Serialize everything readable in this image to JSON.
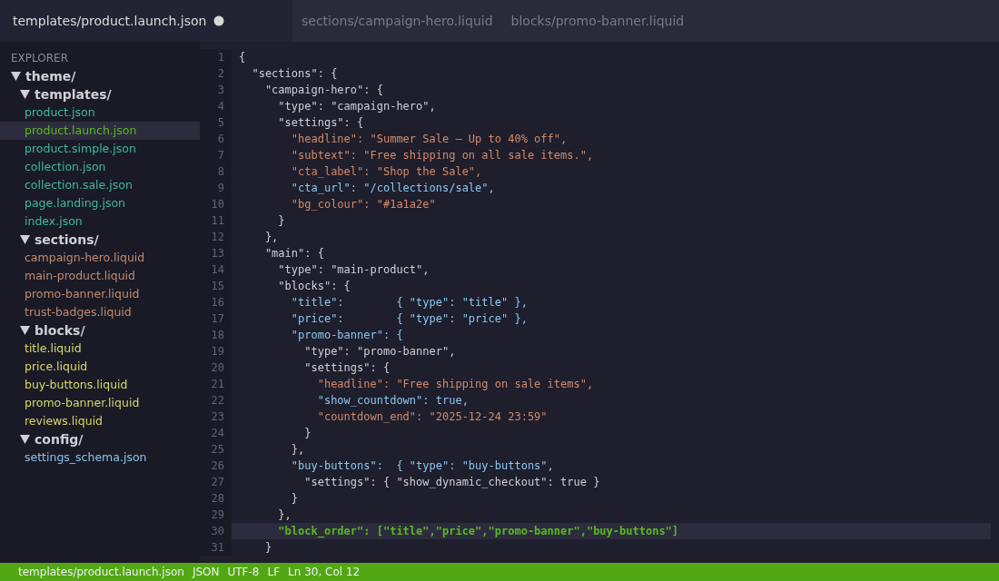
{
  "tabs": [
    {
      "label": "templates/product.launch.json",
      "selected": true,
      "modified": true
    },
    {
      "label": "sections/campaign-hero.liquid",
      "selected": false,
      "modified": false
    },
    {
      "label": "blocks/promo-banner.liquid",
      "selected": false,
      "modified": false
    }
  ],
  "explorer": {
    "title": "EXPLORER",
    "tree": [
      {
        "name": "theme/",
        "expanded": true,
        "children": [
          {
            "name": "templates/",
            "expanded": true,
            "children": [
              {
                "name": "product.json",
                "kind": "template",
                "selected": false
              },
              {
                "name": "product.launch.json",
                "kind": "template",
                "selected": true
              },
              {
                "name": "product.simple.json",
                "kind": "template",
                "selected": false
              },
              {
                "name": "collection.json",
                "kind": "template",
                "selected": false
              },
              {
                "name": "collection.sale.json",
                "kind": "template",
                "selected": false
              },
              {
                "name": "page.landing.json",
                "kind": "template",
                "selected": false
              },
              {
                "name": "index.json",
                "kind": "template",
                "selected": false
              }
            ]
          },
          {
            "name": "sections/",
            "expanded": true,
            "children": [
              {
                "name": "campaign-hero.liquid",
                "kind": "section",
                "selected": false
              },
              {
                "name": "main-product.liquid",
                "kind": "section",
                "selected": false
              },
              {
                "name": "promo-banner.liquid",
                "kind": "section",
                "selected": false
              },
              {
                "name": "trust-badges.liquid",
                "kind": "section",
                "selected": false
              }
            ]
          },
          {
            "name": "blocks/",
            "expanded": true,
            "children": [
              {
                "name": "title.liquid",
                "kind": "block",
                "selected": false
              },
              {
                "name": "price.liquid",
                "kind": "block",
                "selected": false
              },
              {
                "name": "buy-buttons.liquid",
                "kind": "block",
                "selected": false
              },
              {
                "name": "promo-banner.liquid",
                "kind": "block",
                "selected": false
              },
              {
                "name": "reviews.liquid",
                "kind": "block",
                "selected": false
              }
            ]
          },
          {
            "name": "config/",
            "expanded": true,
            "children": [
              {
                "name": "settings_schema.json",
                "kind": "config",
                "selected": false
              }
            ]
          }
        ]
      }
    ]
  },
  "editor": {
    "lines": [
      {
        "number": "1",
        "text": "{",
        "kind": "plain",
        "selected": false
      },
      {
        "number": "2",
        "text": "  \"sections\": {",
        "kind": "plain",
        "selected": false
      },
      {
        "number": "3",
        "text": "    \"campaign-hero\": {",
        "kind": "plain",
        "selected": false
      },
      {
        "number": "4",
        "text": "      \"type\": \"campaign-hero\",",
        "kind": "plain",
        "selected": false
      },
      {
        "number": "5",
        "text": "      \"settings\": {",
        "kind": "plain",
        "selected": false
      },
      {
        "number": "6",
        "text": "        \"headline\": \"Summer Sale — Up to 40% off\",",
        "kind": "string",
        "selected": false
      },
      {
        "number": "7",
        "text": "        \"subtext\": \"Free shipping on all sale items.\",",
        "kind": "string",
        "selected": false
      },
      {
        "number": "8",
        "text": "        \"cta_label\": \"Shop the Sale\",",
        "kind": "string",
        "selected": false
      },
      {
        "number": "9",
        "text": "        \"cta_url\": \"/collections/sale\",",
        "kind": "accent",
        "selected": false
      },
      {
        "number": "10",
        "text": "        \"bg_colour\": \"#1a1a2e\"",
        "kind": "string",
        "selected": false
      },
      {
        "number": "11",
        "text": "      }",
        "kind": "plain",
        "selected": false
      },
      {
        "number": "12",
        "text": "    },",
        "kind": "plain",
        "selected": false
      },
      {
        "number": "13",
        "text": "    \"main\": {",
        "kind": "plain",
        "selected": false
      },
      {
        "number": "14",
        "text": "      \"type\": \"main-product\",",
        "kind": "plain",
        "selected": false
      },
      {
        "number": "15",
        "text": "      \"blocks\": {",
        "kind": "plain",
        "selected": false
      },
      {
        "number": "16",
        "text": "        \"title\":        { \"type\": \"title\" },",
        "kind": "accent",
        "selected": false
      },
      {
        "number": "17",
        "text": "        \"price\":        { \"type\": \"price\" },",
        "kind": "accent",
        "selected": false
      },
      {
        "number": "18",
        "text": "        \"promo-banner\": {",
        "kind": "accent",
        "selected": false
      },
      {
        "number": "19",
        "text": "          \"type\": \"promo-banner\",",
        "kind": "plain",
        "selected": false
      },
      {
        "number": "20",
        "text": "          \"settings\": {",
        "kind": "plain",
        "selected": false
      },
      {
        "number": "21",
        "text": "            \"headline\": \"Free shipping on sale items\",",
        "kind": "string",
        "selected": false
      },
      {
        "number": "22",
        "text": "            \"show_countdown\": true,",
        "kind": "accent",
        "selected": false
      },
      {
        "number": "23",
        "text": "            \"countdown_end\": \"2025-12-24 23:59\"",
        "kind": "string",
        "selected": false
      },
      {
        "number": "24",
        "text": "          }",
        "kind": "plain",
        "selected": false
      },
      {
        "number": "25",
        "text": "        },",
        "kind": "plain",
        "selected": false
      },
      {
        "number": "26",
        "text": "        \"buy-buttons\":  { \"type\": \"buy-buttons\",",
        "kind": "accent",
        "selected": false
      },
      {
        "number": "27",
        "text": "          \"settings\": { \"show_dynamic_checkout\": true }",
        "kind": "plain",
        "selected": false
      },
      {
        "number": "28",
        "text": "        }",
        "kind": "plain",
        "selected": false
      },
      {
        "number": "29",
        "text": "      },",
        "kind": "plain",
        "selected": false
      },
      {
        "number": "30",
        "text": "      \"block_order\": [\"title\",\"price\",\"promo-banner\",\"buy-buttons\"]",
        "kind": "green",
        "selected": true
      },
      {
        "number": "31",
        "text": "    }",
        "kind": "plain",
        "selected": false
      }
    ]
  },
  "status_bar": [
    "templates/product.launch.json",
    "JSON",
    "UTF-8",
    "LF",
    "Ln 30, Col 12"
  ]
}
